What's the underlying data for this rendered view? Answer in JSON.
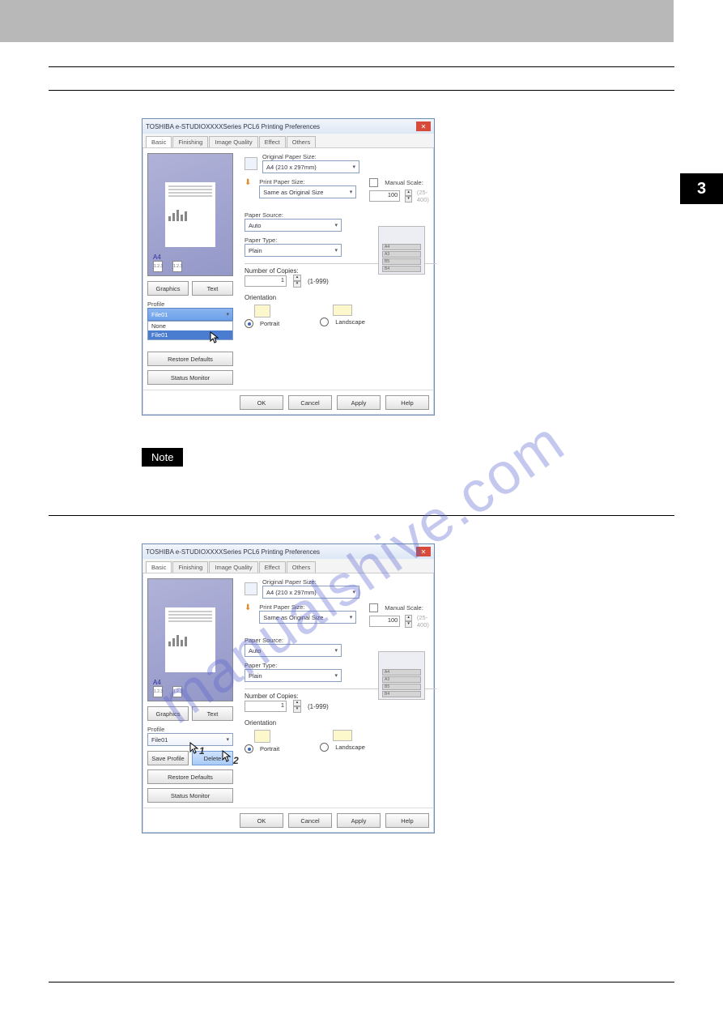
{
  "page": {
    "side_tab": "3"
  },
  "watermark": "manualshive.com",
  "note_label": "Note",
  "dialog": {
    "title": "TOSHIBA e-STUDIOXXXXSeries PCL6 Printing Preferences",
    "tabs": [
      "Basic",
      "Finishing",
      "Image Quality",
      "Effect",
      "Others"
    ],
    "active_tab": "Basic",
    "preview_a4": "A4",
    "preview_seq": "1.2.3",
    "graphics_btn": "Graphics",
    "text_btn": "Text",
    "profile_label": "Profile",
    "profile_value": "File01",
    "dropdown_options": [
      "None",
      "File01"
    ],
    "save_profile_btn": "Save Profile",
    "delete_btn": "Delete",
    "restore_btn": "Restore Defaults",
    "status_btn": "Status Monitor",
    "orig_size_label": "Original Paper Size:",
    "orig_size_value": "A4 (210 x 297mm)",
    "print_size_label": "Print Paper Size:",
    "print_size_value": "Same as Original Size",
    "manual_scale_label": "Manual Scale:",
    "scale_value": "100",
    "scale_range": "(25-400)",
    "source_label": "Paper Source:",
    "source_value": "Auto",
    "type_label": "Paper Type:",
    "type_value": "Plain",
    "trays": [
      "A4",
      "A3",
      "B5",
      "B4"
    ],
    "copies_label": "Number of Copies:",
    "copies_value": "1",
    "copies_range": "(1-999)",
    "orient_label": "Orientation",
    "portrait": "Portrait",
    "landscape": "Landscape",
    "footer": {
      "ok": "OK",
      "cancel": "Cancel",
      "apply": "Apply",
      "help": "Help"
    }
  },
  "step_labels": {
    "one": "1",
    "two": "2"
  }
}
